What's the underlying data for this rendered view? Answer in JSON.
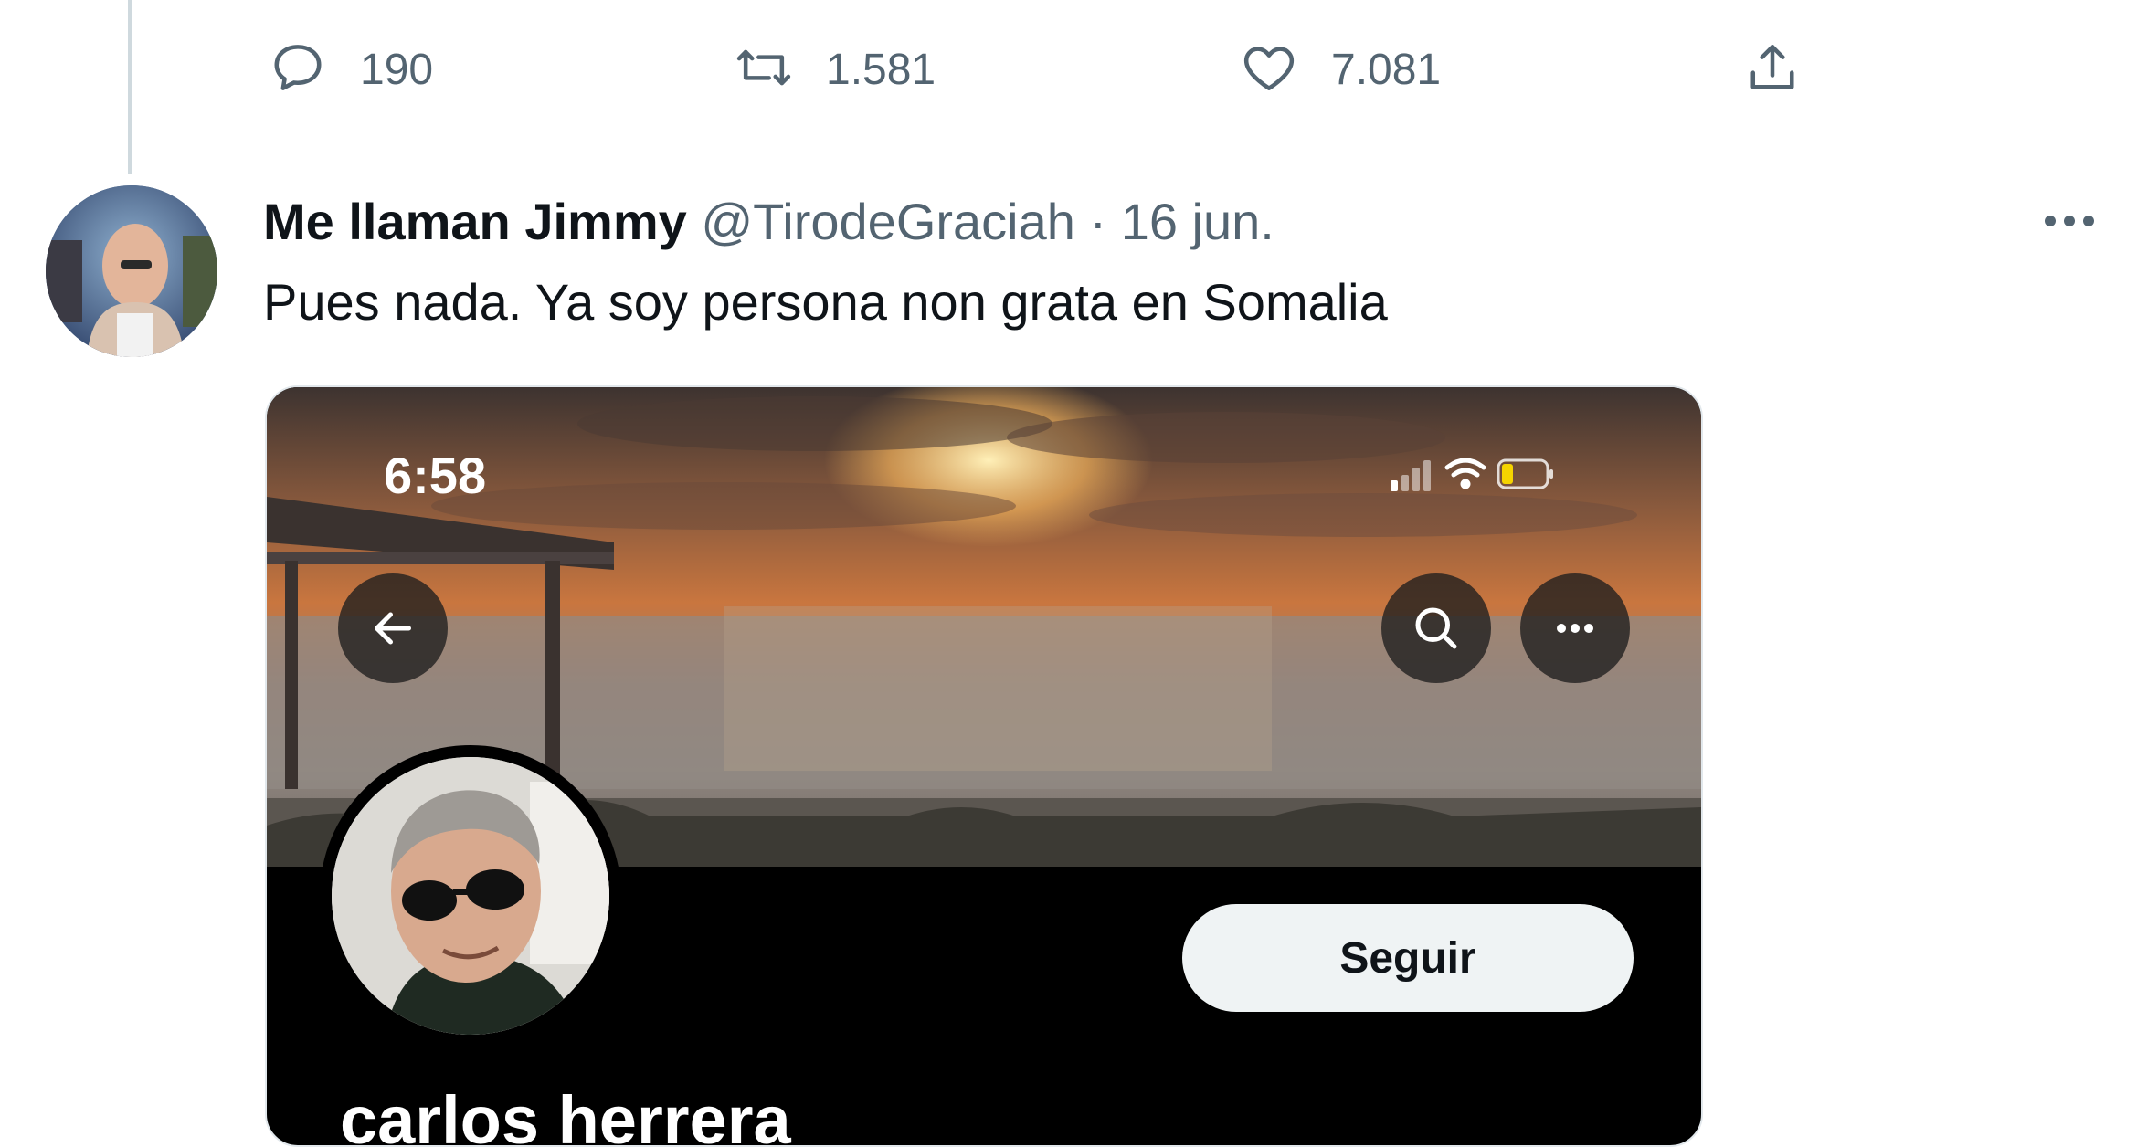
{
  "previous_tweet": {
    "actions": {
      "reply_count": "190",
      "retweet_count": "1.581",
      "like_count": "7.081"
    }
  },
  "tweet": {
    "display_name": "Me llaman Jimmy",
    "handle": "@TirodeGraciah",
    "separator": "·",
    "date": "16 jun.",
    "text": "Pues nada. Ya soy persona non grata en Somalia"
  },
  "embedded_screenshot": {
    "status_time": "6:58",
    "follow_label": "Seguir",
    "profile_name": "carlos herrera"
  },
  "colors": {
    "secondary_text": "#536471",
    "thread_line": "#cfd9de",
    "follow_button_bg": "#eff3f4"
  }
}
